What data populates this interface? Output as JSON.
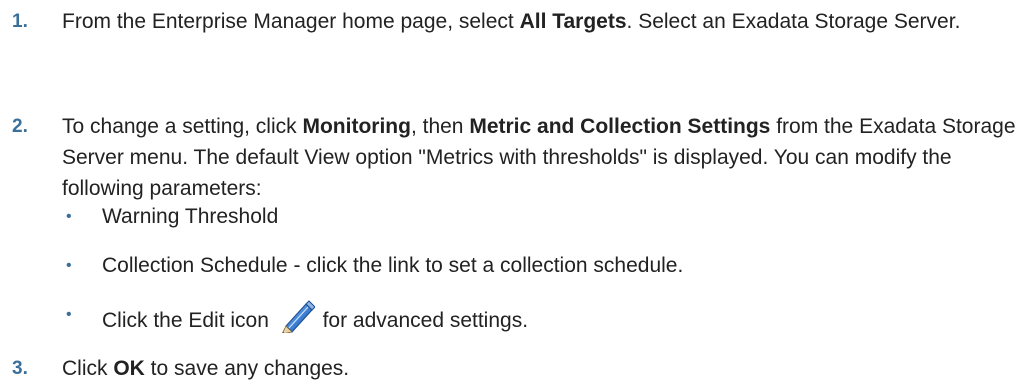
{
  "steps": [
    {
      "number": "1.",
      "pre1": "From the Enterprise Manager home page, select ",
      "bold1": "All Targets",
      "post1": ". Select an Exadata Storage Server."
    },
    {
      "number": "2.",
      "pre1": "To change a setting, click ",
      "bold1": "Monitoring",
      "mid1": ", then ",
      "bold2": "Metric and Collection Settings",
      "post1": " from the Exadata Storage Server menu. The default View option \"Metrics with thresholds\" is displayed. You can modify the following parameters:",
      "bullets": [
        {
          "text": "Warning Threshold"
        },
        {
          "text": "Collection Schedule - click the link to set a collection schedule."
        },
        {
          "pre": "Click the Edit icon ",
          "icon": "pencil-edit-icon",
          "post": " for advanced settings."
        }
      ]
    },
    {
      "number": "3.",
      "pre1": "Click ",
      "bold1": "OK",
      "post1": " to save any changes."
    }
  ],
  "bullet_char": "•",
  "colors": {
    "step_number": "#3a6f9a",
    "text": "#222222",
    "icon_blue": "#2f6fc4"
  }
}
